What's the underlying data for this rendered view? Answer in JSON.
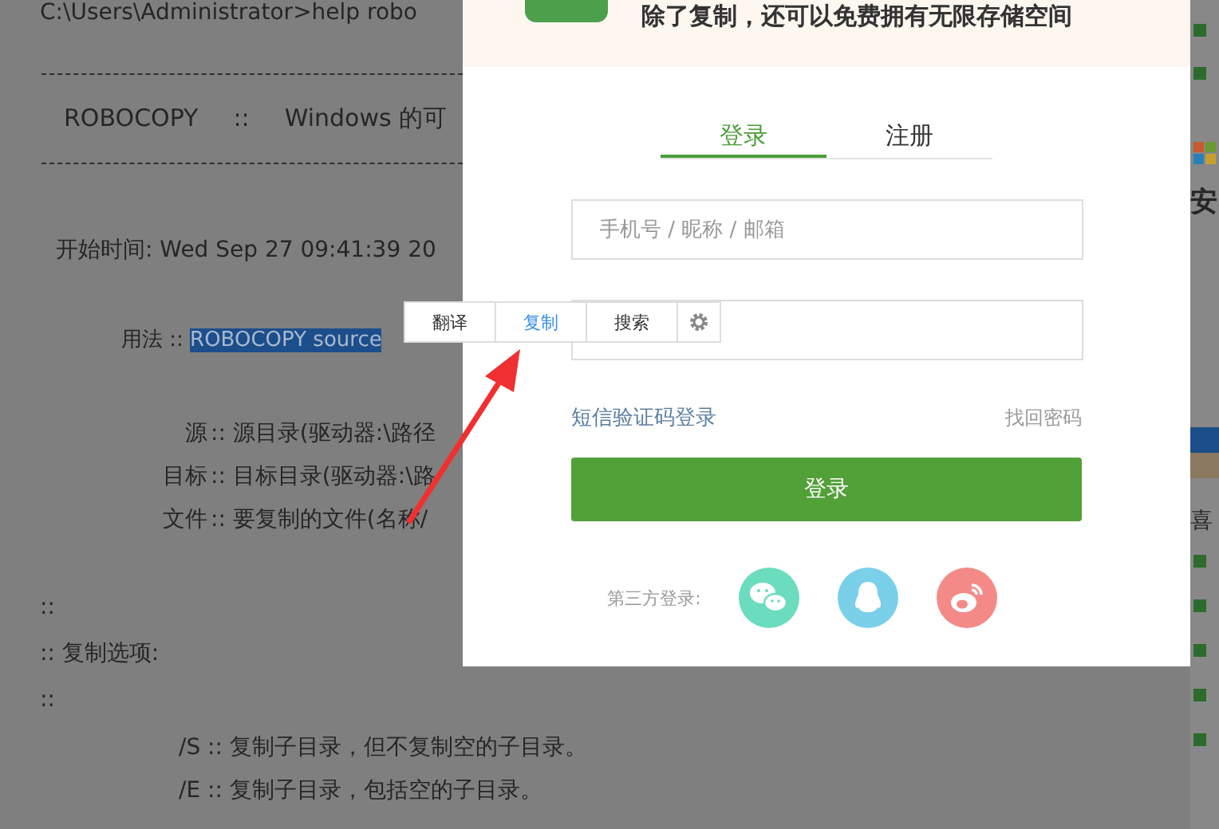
{
  "background_page": {
    "command_line": "C:\\Users\\Administrator>help robo",
    "lines": [
      {
        "kind": "rule"
      },
      {
        "kind": "banner",
        "parts": [
          "ROBOCOPY",
          "::",
          "Windows 的可"
        ]
      },
      {
        "kind": "rule"
      },
      {
        "kind": "heading",
        "text": "开始时间: Wed Sep 27 09:41:39 20"
      },
      {
        "kind": "usage",
        "label": "用法 ::",
        "selection": "ROBOCOPY source"
      },
      {
        "kind": "param",
        "label": "源",
        "text": ":: 源目录(驱动器:\\路径"
      },
      {
        "kind": "param",
        "label": "目标",
        "text": ":: 目标目录(驱动器:\\路"
      },
      {
        "kind": "param",
        "label": "文件",
        "text": ":: 要复制的文件(名称/"
      },
      {
        "kind": "comment",
        "text": "::"
      },
      {
        "kind": "comment",
        "text": ":: 复制选项:"
      },
      {
        "kind": "comment",
        "text": "::"
      },
      {
        "kind": "option",
        "text": "/S :: 复制子目录，但不复制空的子目录。"
      },
      {
        "kind": "option",
        "text": "/E :: 复制子目录，包括空的子目录。"
      }
    ],
    "sidebar": {
      "ad_heading": "安",
      "section_heading": "喜"
    }
  },
  "selection_toolbar": {
    "items": [
      {
        "label": "翻译",
        "selected": false
      },
      {
        "label": "复制",
        "selected": true
      },
      {
        "label": "搜索",
        "selected": false
      }
    ]
  },
  "login_dialog": {
    "promo": "除了复制，还可以免费拥有无限存储空间",
    "tabs": [
      {
        "label": "登录",
        "selected": true
      },
      {
        "label": "注册",
        "selected": false
      }
    ],
    "account_field": {
      "placeholder": "手机号 / 昵称 / 邮箱"
    },
    "sms_login_link": "短信验证码登录",
    "forgot_password_link": "找回密码",
    "login_button": "登录",
    "third_party": {
      "label": "第三方登录:",
      "providers": [
        {
          "kind": "wechat",
          "color": "#6cdcbe"
        },
        {
          "kind": "qq",
          "color": "#7acfe9"
        },
        {
          "kind": "weibo",
          "color": "#f38a88"
        }
      ]
    }
  }
}
